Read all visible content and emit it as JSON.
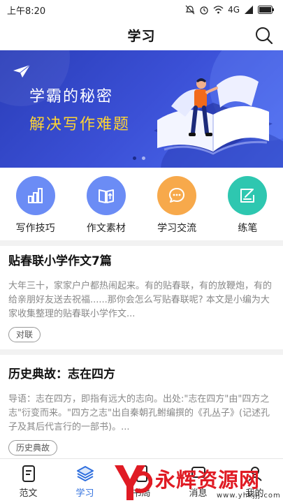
{
  "status_bar": {
    "time": "上午8:20",
    "network": "4G"
  },
  "header": {
    "title": "学习"
  },
  "banner": {
    "line1": "学霸的秘密",
    "line2": "解决写作难题",
    "dot_count": 2,
    "active_dot": 0
  },
  "quick_menu": [
    {
      "label": "写作技巧",
      "color": "#6b8cf5",
      "icon": "bar-chart-icon"
    },
    {
      "label": "作文素材",
      "color": "#6b8cf5",
      "icon": "book-upload-icon"
    },
    {
      "label": "学习交流",
      "color": "#f7a94b",
      "icon": "chat-bubble-icon"
    },
    {
      "label": "练笔",
      "color": "#2ec7b0",
      "icon": "edit-note-icon"
    }
  ],
  "articles": [
    {
      "title": "贴春联小学作文7篇",
      "summary": "大年三十，家家户户都热闹起来。有的贴春联，有的放鞭炮，有的给亲朋好友送去祝福......那你会怎么写贴春联呢? 本文是小编为大家收集整理的贴春联小学作文...",
      "tag": "对联"
    },
    {
      "title": "历史典故：志在四方",
      "summary": "导语：志在四方，即指有远大的志向。出处:\"志在四方\"由\"四方之志\"衍变而来。\"四方之志\"出自秦朝孔鲋编撰的《孔丛子》(记述孔子及其后代言行的一部书)。...",
      "tag": "历史典故"
    }
  ],
  "tab_bar": [
    {
      "label": "范文",
      "icon": "document-icon",
      "active": false
    },
    {
      "label": "学习",
      "icon": "layers-icon",
      "active": true
    },
    {
      "label": "书局",
      "icon": "book-icon",
      "active": false
    },
    {
      "label": "消息",
      "icon": "message-icon",
      "active": false
    },
    {
      "label": "我的",
      "icon": "user-icon",
      "active": false
    }
  ],
  "watermark": {
    "text": "永辉资源网",
    "url": "www.yhkjjj.com"
  },
  "colors": {
    "accent": "#2f6fde",
    "banner_bg": "#3b50d6",
    "banner_highlight": "#ffd433"
  }
}
